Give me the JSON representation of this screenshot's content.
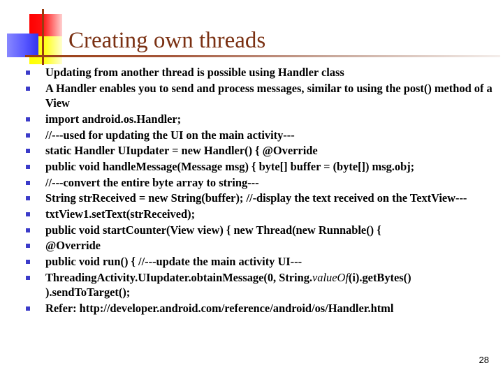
{
  "slide": {
    "title": "Creating own threads",
    "page_number": "28",
    "colors": {
      "title": "#7a3012",
      "bullet": "#3b3bc9",
      "rule": "#9a3c10"
    }
  },
  "bullets": [
    {
      "text": "Updating from another thread is possible using Handler class"
    },
    {
      "text": "A Handler enables you to send and process messages, similar to using the post() method of a View"
    },
    {
      "text": "import android.os.Handler;"
    },
    {
      "text": "//---used for updating the UI on the main activity---"
    },
    {
      "text": "static Handler UIupdater = new Handler() { @Override"
    },
    {
      "text": "public void handleMessage(Message msg) { byte[] buffer = (byte[]) msg.obj;"
    },
    {
      "text": "//---convert the entire byte array to string---"
    },
    {
      "text": "String strReceived = new String(buffer); //-display the text received on the TextView---"
    },
    {
      "text": "txtView1.setText(strReceived);"
    },
    {
      "text": "public void startCounter(View view) { new Thread(new Runnable() {"
    },
    {
      "text": "@Override"
    },
    {
      "text": "public void run() { //---update the main activity UI---"
    },
    {
      "before": "ThreadingActivity.UIupdater.obtainMessage(0, String.",
      "italic": "valueOf",
      "after": "(i).getBytes() ).sendToTarget();"
    },
    {
      "text": "Refer: http://developer.android.com/reference/android/os/Handler.html"
    }
  ]
}
